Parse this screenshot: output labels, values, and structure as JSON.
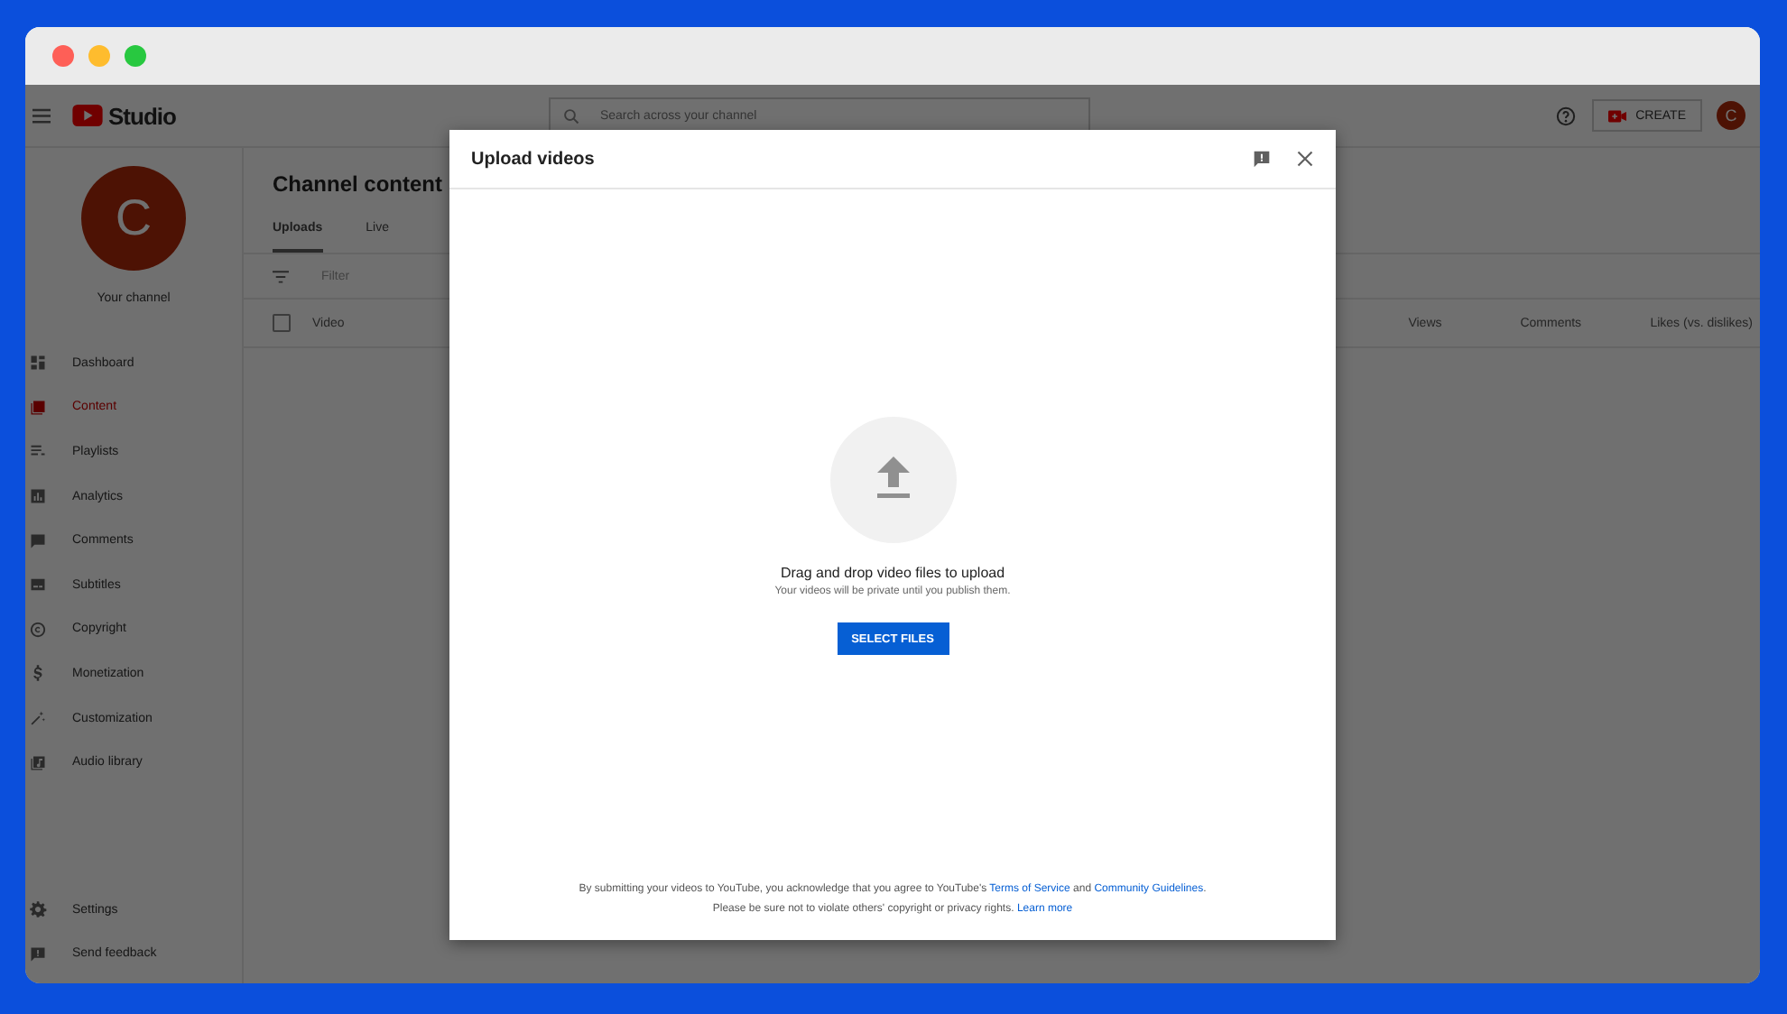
{
  "header": {
    "logo_text": "Studio",
    "search": {
      "placeholder": "Search across your channel"
    },
    "create_button": "CREATE",
    "avatar": "C"
  },
  "sidebar": {
    "avatar": "C",
    "channel_label": "Your channel",
    "items": [
      {
        "label": "Dashboard",
        "selected": false
      },
      {
        "label": "Content",
        "selected": true
      },
      {
        "label": "Playlists",
        "selected": false
      },
      {
        "label": "Analytics",
        "selected": false
      },
      {
        "label": "Comments",
        "selected": false
      },
      {
        "label": "Subtitles",
        "selected": false
      },
      {
        "label": "Copyright",
        "selected": false
      },
      {
        "label": "Monetization",
        "selected": false
      },
      {
        "label": "Customization",
        "selected": false
      },
      {
        "label": "Audio library",
        "selected": false
      }
    ],
    "bottom_items": [
      {
        "label": "Settings"
      },
      {
        "label": "Send feedback"
      }
    ]
  },
  "content": {
    "title": "Channel content",
    "tabs": [
      {
        "label": "Uploads",
        "selected": true
      },
      {
        "label": "Live",
        "selected": false
      }
    ],
    "filter": {
      "placeholder": "Filter"
    },
    "select_all": {
      "checked": false
    },
    "columns": [
      "Video",
      "Views",
      "Comments",
      "Likes (vs. dislikes)"
    ]
  },
  "dialog": {
    "title": "Upload videos",
    "prompt": "Drag and drop video files to upload",
    "note": "Your videos will be private until you publish them.",
    "button": "SELECT FILES",
    "footer": [
      [
        {
          "kind": "text",
          "text": "By submitting your videos to YouTube, you acknowledge that you agree to YouTube's "
        },
        {
          "kind": "link",
          "text": "Terms of Service"
        },
        {
          "kind": "text",
          "text": " and "
        },
        {
          "kind": "link",
          "text": "Community Guidelines"
        },
        {
          "kind": "text",
          "text": "."
        }
      ],
      [
        {
          "kind": "text",
          "text": "Please be sure not to violate others' copyright or privacy rights. "
        },
        {
          "kind": "link",
          "text": "Learn more"
        }
      ]
    ]
  }
}
